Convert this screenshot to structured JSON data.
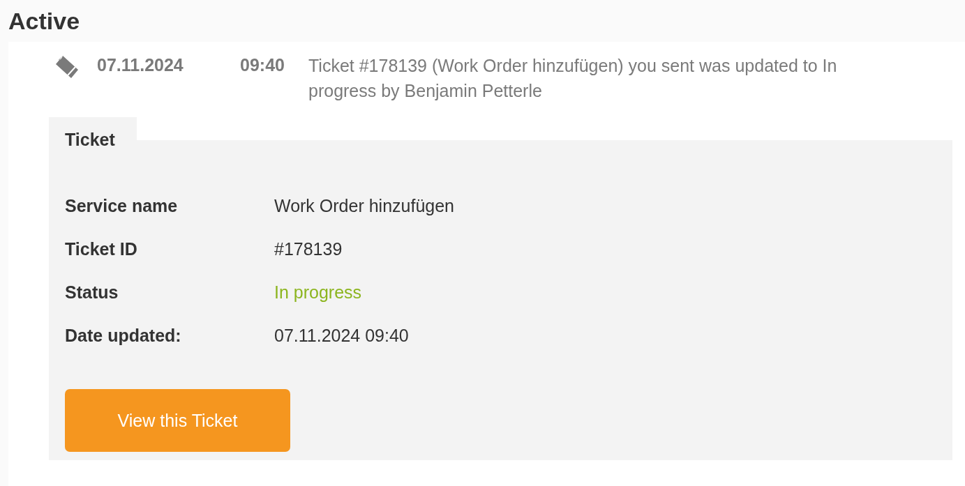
{
  "heading": "Active",
  "entry": {
    "date": "07.11.2024",
    "time": "09:40",
    "message": "Ticket #178139 (Work Order hinzufügen) you sent was updated to In progress by Benjamin Petterle",
    "panel": {
      "tab": "Ticket",
      "fields": [
        {
          "label": "Service name",
          "value": "Work Order hinzufügen"
        },
        {
          "label": "Ticket ID",
          "value": "#178139"
        },
        {
          "label": "Status",
          "value": "In progress",
          "color": "#8cb51f"
        },
        {
          "label": "Date updated:",
          "value": "07.11.2024 09:40"
        }
      ],
      "button": "View this Ticket"
    }
  }
}
